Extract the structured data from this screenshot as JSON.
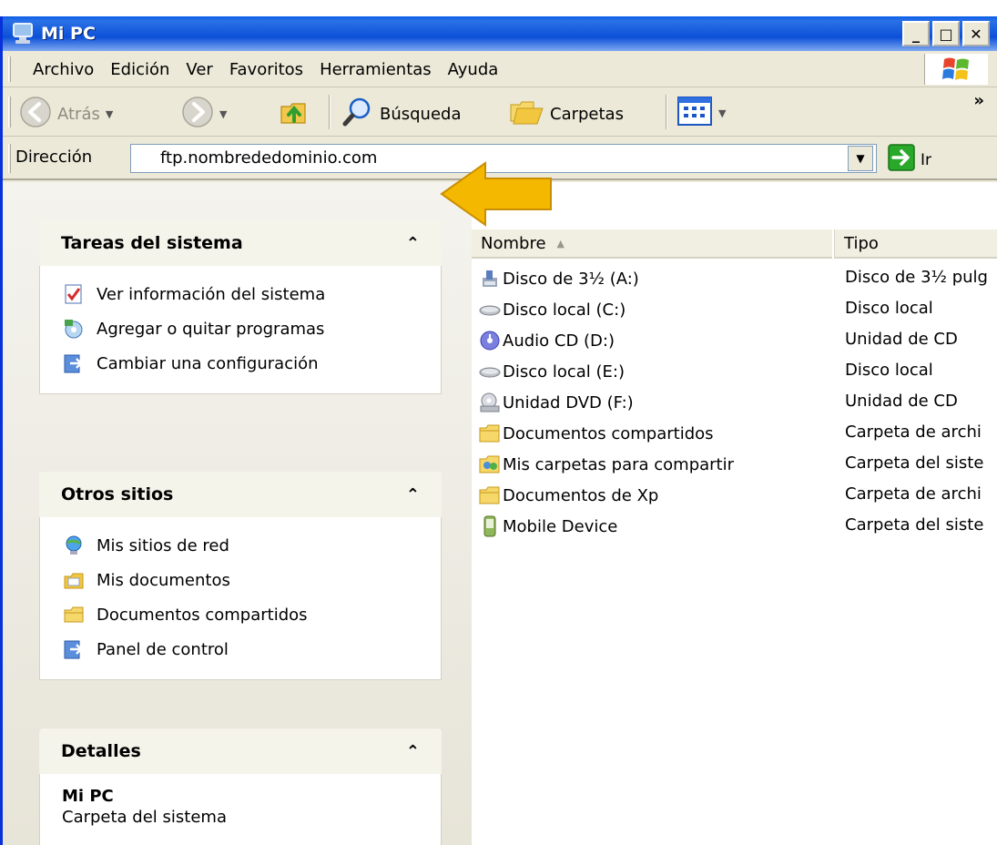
{
  "window": {
    "title": "Mi PC",
    "minimize": "_",
    "maximize": "□",
    "close": "✕"
  },
  "menu": [
    "Archivo",
    "Edición",
    "Ver",
    "Favoritos",
    "Herramientas",
    "Ayuda"
  ],
  "toolbar": {
    "back_label": "Atrás",
    "search_label": "Búsqueda",
    "folders_label": "Carpetas",
    "more": "»"
  },
  "address": {
    "label": "Dirección",
    "value": "ftp.nombrededominio.com",
    "go_label": "Ir"
  },
  "panels": {
    "system_tasks": {
      "title": "Tareas del sistema",
      "items": [
        "Ver información del sistema",
        "Agregar o quitar programas",
        "Cambiar una configuración"
      ]
    },
    "other_places": {
      "title": "Otros sitios",
      "items": [
        "Mis sitios de red",
        "Mis documentos",
        "Documentos compartidos",
        "Panel de control"
      ]
    },
    "details": {
      "title": "Detalles",
      "name": "Mi PC",
      "desc": "Carpeta del sistema"
    }
  },
  "list": {
    "col_name": "Nombre",
    "col_type": "Tipo",
    "rows": [
      {
        "name": "Disco de 3½ (A:)",
        "type": "Disco de 3½ pulg",
        "icon": "floppy-icon"
      },
      {
        "name": "Disco local (C:)",
        "type": "Disco local",
        "icon": "hard-drive-icon"
      },
      {
        "name": "Audio CD (D:)",
        "type": "Unidad de CD",
        "icon": "audio-cd-icon"
      },
      {
        "name": "Disco local (E:)",
        "type": "Disco local",
        "icon": "hard-drive-icon"
      },
      {
        "name": "Unidad DVD (F:)",
        "type": "Unidad de CD",
        "icon": "dvd-drive-icon"
      },
      {
        "name": "Documentos compartidos",
        "type": "Carpeta de archi",
        "icon": "folder-icon"
      },
      {
        "name": "Mis carpetas para compartir",
        "type": "Carpeta del siste",
        "icon": "shared-folder-icon"
      },
      {
        "name": "Documentos de Xp",
        "type": "Carpeta de archi",
        "icon": "folder-icon"
      },
      {
        "name": "Mobile Device",
        "type": "Carpeta del siste",
        "icon": "mobile-device-icon"
      }
    ]
  },
  "colors": {
    "titlebar": "#0a5de8",
    "callout_arrow": "#f5b800",
    "go_button": "#2aa82a"
  }
}
